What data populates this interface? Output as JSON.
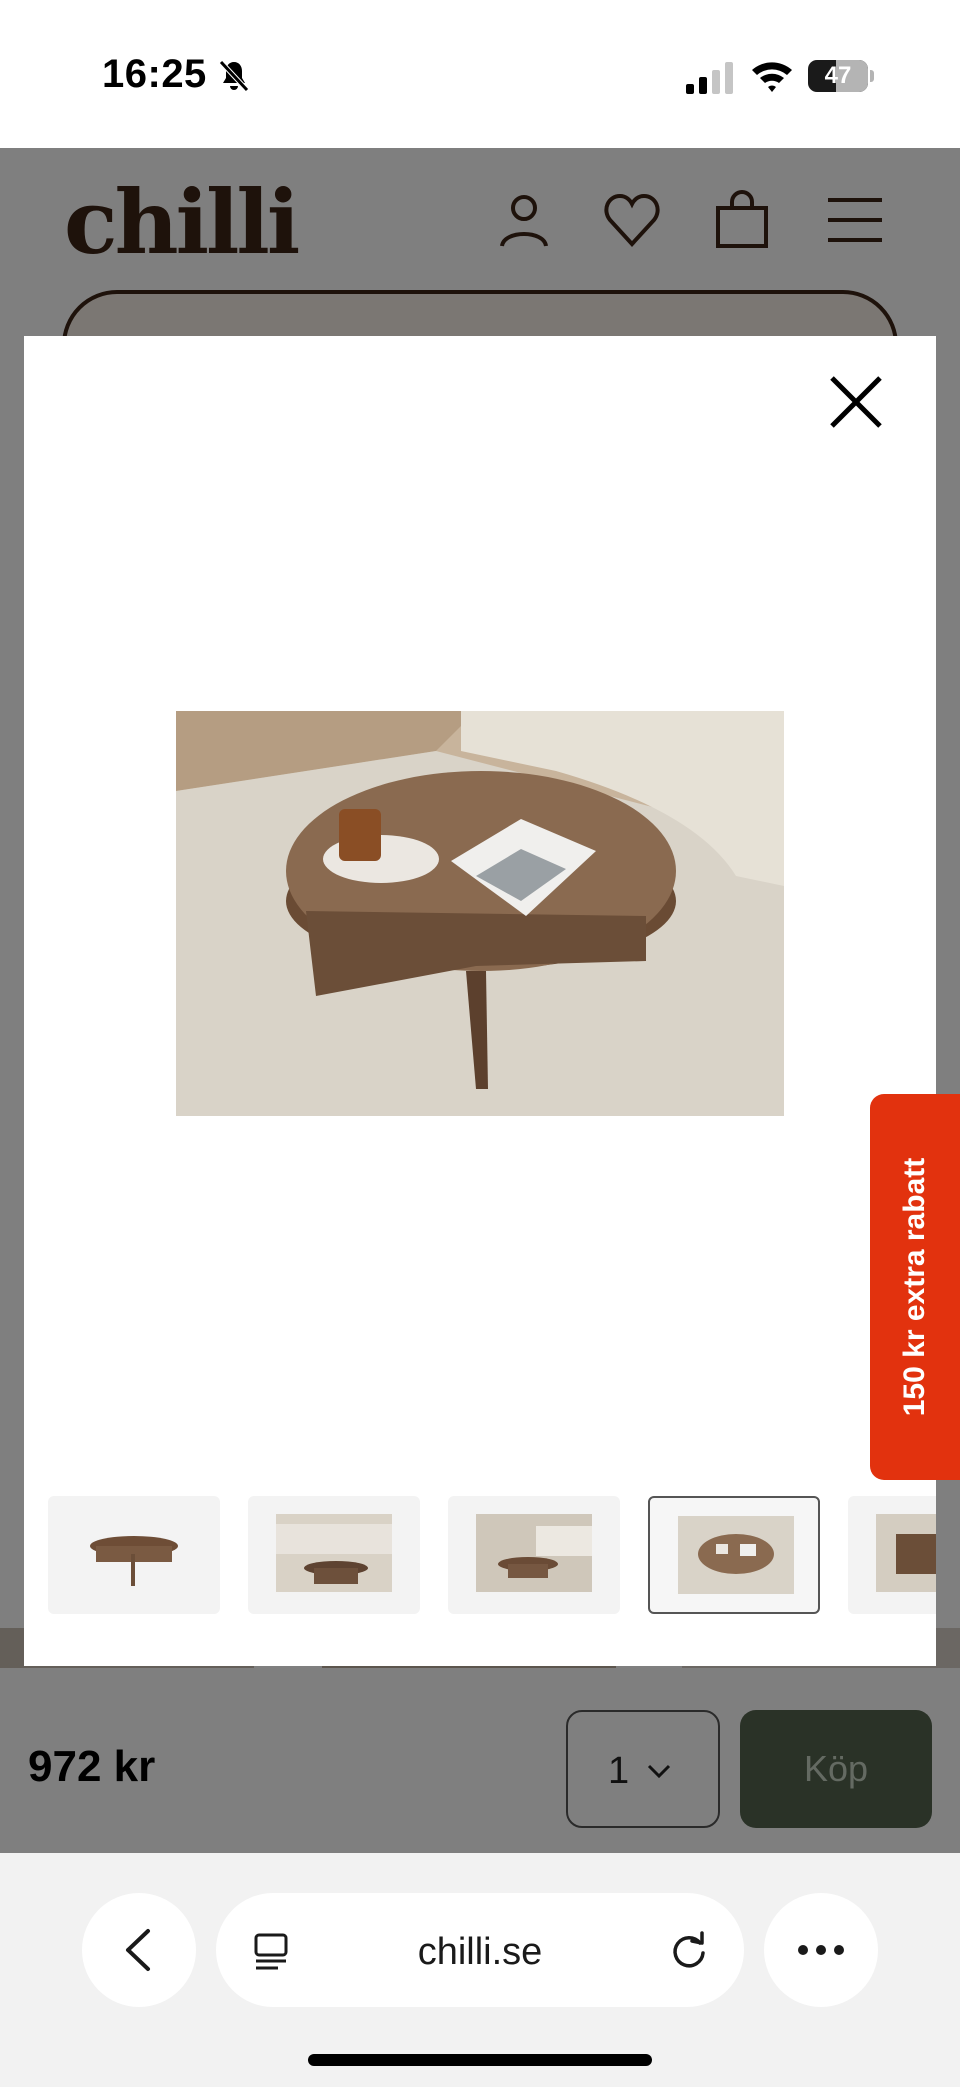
{
  "status_bar": {
    "time": "16:25",
    "battery": "47",
    "battery_level": 0.47,
    "icons": [
      "bell-muted-icon",
      "signal-icon",
      "wifi-icon",
      "battery-icon"
    ]
  },
  "site": {
    "logo": "chilli",
    "header_icons": [
      "account-icon",
      "heart-icon",
      "shopping-bag-icon",
      "hamburger-menu-icon"
    ],
    "brand_color": "#3d2416"
  },
  "buybar": {
    "price": "972 kr",
    "quantity": "1",
    "buy_label": "Köp",
    "buy_color": "#54644f"
  },
  "modal": {
    "close_icon": "close-icon",
    "thumbnails": [
      {
        "id": "product",
        "selected": false
      },
      {
        "id": "living-room-1",
        "selected": false
      },
      {
        "id": "living-room-2",
        "selected": false
      },
      {
        "id": "top-view",
        "selected": true
      },
      {
        "id": "detail",
        "selected": false
      }
    ]
  },
  "promo": {
    "label": "150 kr extra rabatt",
    "color": "#e2320e"
  },
  "browser": {
    "url": "chilli.se",
    "icons": [
      "back-icon",
      "tab-overview-icon",
      "reload-icon",
      "more-icon"
    ]
  }
}
